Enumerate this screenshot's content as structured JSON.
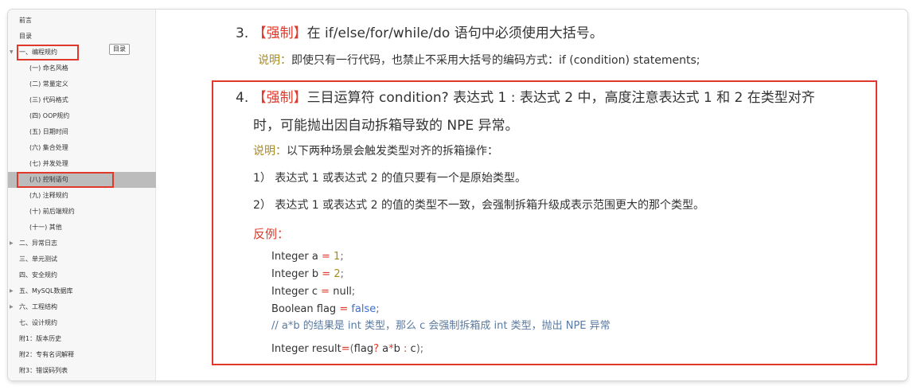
{
  "sidebar": {
    "tooltip": "目录",
    "items": [
      {
        "label": "前言",
        "level": 0,
        "arrow": ""
      },
      {
        "label": "目录",
        "level": 0,
        "arrow": ""
      },
      {
        "label": "一、编程规约",
        "level": 0,
        "arrow": "▼"
      },
      {
        "label": "(一) 命名风格",
        "level": 1,
        "arrow": ""
      },
      {
        "label": "(二) 常量定义",
        "level": 1,
        "arrow": ""
      },
      {
        "label": "(三) 代码格式",
        "level": 1,
        "arrow": ""
      },
      {
        "label": "(四) OOP规约",
        "level": 1,
        "arrow": ""
      },
      {
        "label": "(五) 日期时间",
        "level": 1,
        "arrow": ""
      },
      {
        "label": "(六) 集合处理",
        "level": 1,
        "arrow": ""
      },
      {
        "label": "(七) 并发处理",
        "level": 1,
        "arrow": ""
      },
      {
        "label": "(八) 控制语句",
        "level": 1,
        "arrow": "",
        "active": true
      },
      {
        "label": "(九) 注释规约",
        "level": 1,
        "arrow": ""
      },
      {
        "label": "(十) 前后端规约",
        "level": 1,
        "arrow": ""
      },
      {
        "label": "(十一) 其他",
        "level": 1,
        "arrow": ""
      },
      {
        "label": "二、异常日志",
        "level": 0,
        "arrow": "▶"
      },
      {
        "label": "三、单元测试",
        "level": 0,
        "arrow": ""
      },
      {
        "label": "四、安全规约",
        "level": 0,
        "arrow": ""
      },
      {
        "label": "五、MySQL数据库",
        "level": 0,
        "arrow": "▶"
      },
      {
        "label": "六、工程结构",
        "level": 0,
        "arrow": "▶"
      },
      {
        "label": "七、设计规约",
        "level": 0,
        "arrow": ""
      },
      {
        "label": "附1：版本历史",
        "level": 0,
        "arrow": ""
      },
      {
        "label": "附2：专有名词解释",
        "level": 0,
        "arrow": ""
      },
      {
        "label": "附3：错误码列表",
        "level": 0,
        "arrow": ""
      }
    ]
  },
  "content": {
    "rule3": {
      "num": "3.",
      "tag": "【强制】",
      "text": "在 if/else/for/while/do 语句中必须使用大括号。",
      "note_label": "说明：",
      "note_text": "即使只有一行代码，也禁止不采用大括号的编码方式：if (condition) statements;"
    },
    "rule4": {
      "num": "4.",
      "tag": "【强制】",
      "text_line1": "三目运算符 condition? 表达式 1 : 表达式 2 中，高度注意表达式 1 和 2 在类型对齐",
      "text_line2": "时，可能抛出因自动拆箱导致的 NPE 异常。",
      "note_label": "说明：",
      "note_text": "以下两种场景会触发类型对齐的拆箱操作：",
      "case1": "1） 表达式 1 或表达式 2 的值只要有一个是原始类型。",
      "case2": "2） 表达式 1 或表达式 2 的值的类型不一致，会强制拆箱升级成表示范围更大的那个类型。",
      "counter_label": "反例：",
      "code": {
        "l1_a": "Integer a",
        "l1_eq": " = ",
        "l1_v": "1",
        "l1_s": ";",
        "l2_a": "Integer b",
        "l2_eq": " = ",
        "l2_v": "2",
        "l2_s": ";",
        "l3_a": "Integer c",
        "l3_eq": " = ",
        "l3_v": "null",
        "l3_s": ";",
        "l4_a": "Boolean flag",
        "l4_eq": " = ",
        "l4_v": "false",
        "l4_s": ";",
        "comment": "// a*b 的结果是 int 类型，那么 c 会强制拆箱成 int 类型，抛出 NPE 异常",
        "l6_a": "Integer result",
        "l6_eq": "=",
        "l6_p1": "(",
        "l6_b": "flag",
        "l6_q": "?",
        "l6_c": " a",
        "l6_st": "*",
        "l6_d": "b",
        "l6_co": " : ",
        "l6_e": "c",
        "l6_end": ");"
      }
    }
  },
  "colors": {
    "highlight": "#e0392b",
    "tag": "#e0392b",
    "note": "#a88b1e",
    "keyword": "#3d6fd1"
  }
}
